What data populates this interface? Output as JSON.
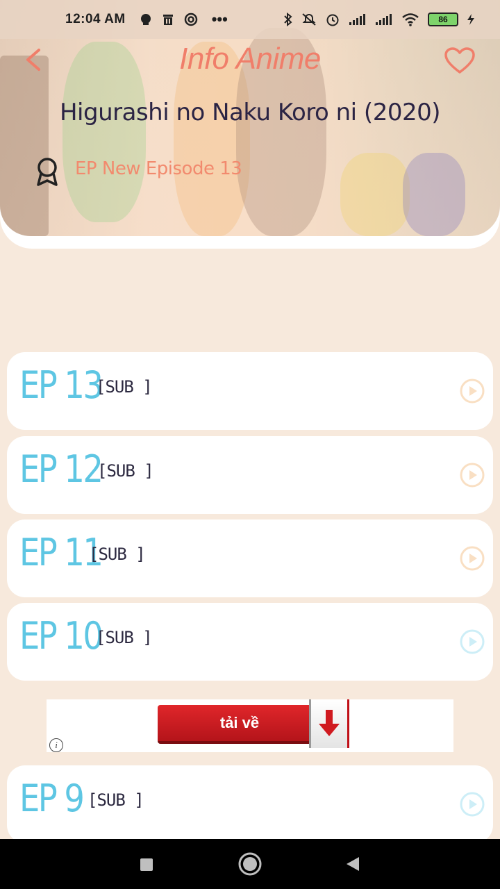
{
  "status_bar": {
    "time": "12:04 AM",
    "dots": "•••",
    "battery": "86",
    "icons": [
      "chat-icon",
      "trash-icon",
      "sync-icon",
      "bluetooth-icon",
      "mute-icon",
      "alarm-icon",
      "signal-icon",
      "wifi-icon",
      "charging-icon"
    ]
  },
  "header": {
    "title": "Info Anime",
    "anime_name": "Higurashi no Naku Koro ni (2020)",
    "new_episode": "EP New Episode 13",
    "accent_color": "#f07e6a"
  },
  "episodes": [
    {
      "label": "EP 13",
      "tag": "[SUB ]"
    },
    {
      "label": "EP 12",
      "tag": "[SUB ]"
    },
    {
      "label": "EP 11",
      "tag": "[SUB ]"
    },
    {
      "label": "EP 10",
      "tag": "[SUB ]"
    },
    {
      "label": "EP 9",
      "tag": "[SUB ]"
    }
  ],
  "ad": {
    "button_label": "tải về",
    "info": "i"
  },
  "colors": {
    "episode_number": "#5ec6e3",
    "background": "#f7e9dc"
  }
}
